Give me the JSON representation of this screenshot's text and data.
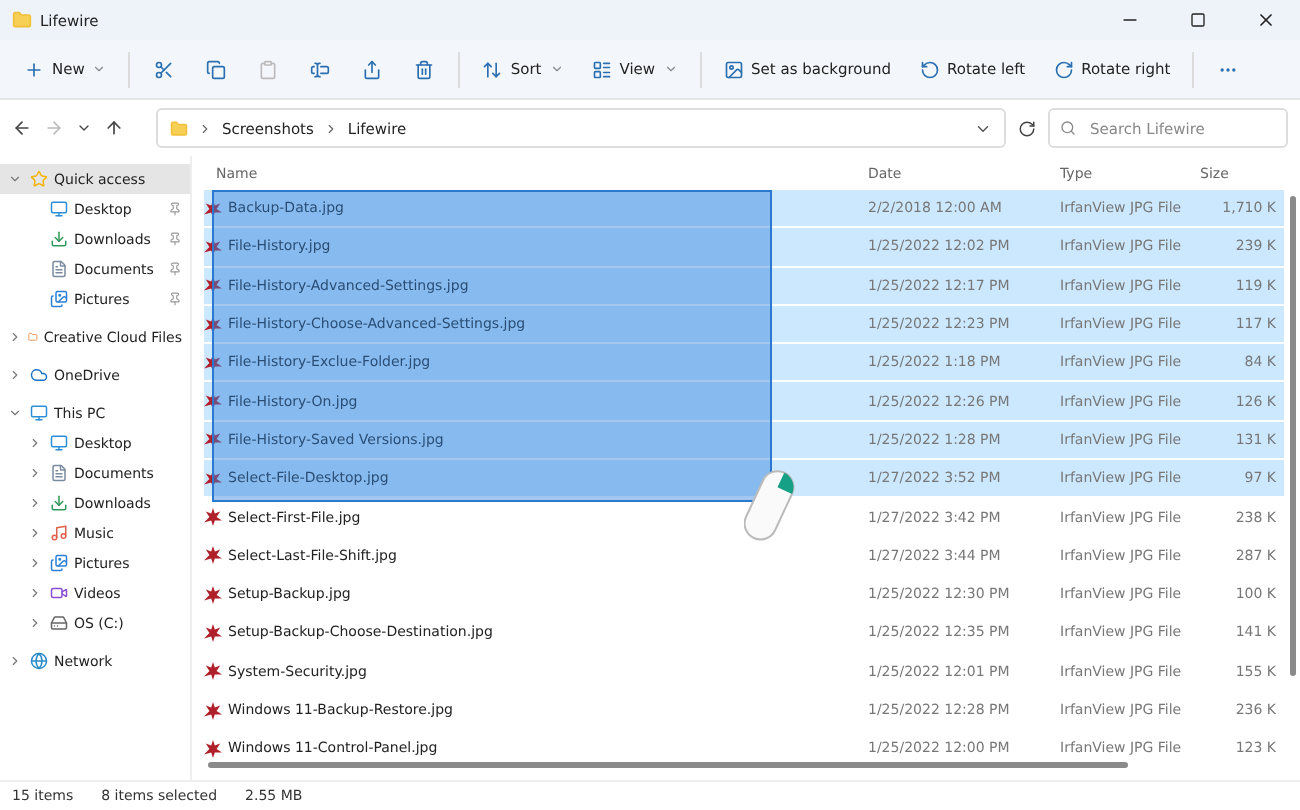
{
  "window": {
    "title": "Lifewire"
  },
  "toolbar": [
    {
      "kind": "new",
      "label": "New",
      "caret": true
    },
    {
      "kind": "cut",
      "disabled": false
    },
    {
      "kind": "copy",
      "disabled": false
    },
    {
      "kind": "paste",
      "disabled": true
    },
    {
      "kind": "rename",
      "disabled": false
    },
    {
      "kind": "share",
      "disabled": false
    },
    {
      "kind": "delete",
      "disabled": false
    },
    {
      "kind": "sort",
      "label": "Sort",
      "caret": true
    },
    {
      "kind": "view",
      "label": "View",
      "caret": true
    },
    {
      "kind": "background",
      "label": "Set as background"
    },
    {
      "kind": "rotleft",
      "label": "Rotate left"
    },
    {
      "kind": "rotright",
      "label": "Rotate right"
    },
    {
      "kind": "more"
    }
  ],
  "address": {
    "path": [
      "Screenshots",
      "Lifewire"
    ],
    "search_placeholder": "Search Lifewire"
  },
  "sidebar": {
    "items": [
      {
        "label": "Quick access",
        "kind": "star",
        "expanded": true,
        "selected": true,
        "children": [
          {
            "label": "Desktop",
            "kind": "desktop",
            "pinned": true,
            "selected": false
          },
          {
            "label": "Downloads",
            "kind": "download",
            "pinned": true,
            "selected": false
          },
          {
            "label": "Documents",
            "kind": "document",
            "pinned": true,
            "selected": false
          },
          {
            "label": "Pictures",
            "kind": "pictures",
            "pinned": true,
            "selected": false
          }
        ]
      },
      {
        "label": "Creative Cloud Files",
        "kind": "cloudfolder",
        "expanded": false,
        "selected": false
      },
      {
        "label": "OneDrive",
        "kind": "cloud",
        "expanded": false,
        "selected": false
      },
      {
        "label": "This PC",
        "kind": "pc",
        "expanded": true,
        "selected": false,
        "children": [
          {
            "label": "Desktop",
            "kind": "desktop",
            "expanded": false,
            "selected": false
          },
          {
            "label": "Documents",
            "kind": "document",
            "expanded": false,
            "selected": false
          },
          {
            "label": "Downloads",
            "kind": "download",
            "expanded": false,
            "selected": false
          },
          {
            "label": "Music",
            "kind": "music",
            "expanded": false,
            "selected": false
          },
          {
            "label": "Pictures",
            "kind": "pictures",
            "expanded": false,
            "selected": false
          },
          {
            "label": "Videos",
            "kind": "videos",
            "expanded": false,
            "selected": false
          },
          {
            "label": "OS (C:)",
            "kind": "drive",
            "expanded": false,
            "selected": false
          }
        ]
      },
      {
        "label": "Network",
        "kind": "network",
        "expanded": false,
        "selected": false
      }
    ]
  },
  "table": {
    "columns": [
      "Name",
      "Date",
      "Type",
      "Size"
    ],
    "rows": [
      {
        "name": "Backup-Data.jpg",
        "date": "2/2/2018 12:00 AM",
        "type": "IrfanView JPG File",
        "size": "1,710 K",
        "selected": true
      },
      {
        "name": "File-History.jpg",
        "date": "1/25/2022 12:02 PM",
        "type": "IrfanView JPG File",
        "size": "239 K",
        "selected": true
      },
      {
        "name": "File-History-Advanced-Settings.jpg",
        "date": "1/25/2022 12:17 PM",
        "type": "IrfanView JPG File",
        "size": "119 K",
        "selected": true
      },
      {
        "name": "File-History-Choose-Advanced-Settings.jpg",
        "date": "1/25/2022 12:23 PM",
        "type": "IrfanView JPG File",
        "size": "117 K",
        "selected": true
      },
      {
        "name": "File-History-Exclue-Folder.jpg",
        "date": "1/25/2022 1:18 PM",
        "type": "IrfanView JPG File",
        "size": "84 K",
        "selected": true
      },
      {
        "name": "File-History-On.jpg",
        "date": "1/25/2022 12:26 PM",
        "type": "IrfanView JPG File",
        "size": "126 K",
        "selected": true
      },
      {
        "name": "File-History-Saved Versions.jpg",
        "date": "1/25/2022 1:28 PM",
        "type": "IrfanView JPG File",
        "size": "131 K",
        "selected": true
      },
      {
        "name": "Select-File-Desktop.jpg",
        "date": "1/27/2022 3:52 PM",
        "type": "IrfanView JPG File",
        "size": "97 K",
        "selected": true
      },
      {
        "name": "Select-First-File.jpg",
        "date": "1/27/2022 3:42 PM",
        "type": "IrfanView JPG File",
        "size": "238 K",
        "selected": false
      },
      {
        "name": "Select-Last-File-Shift.jpg",
        "date": "1/27/2022 3:44 PM",
        "type": "IrfanView JPG File",
        "size": "287 K",
        "selected": false
      },
      {
        "name": "Setup-Backup.jpg",
        "date": "1/25/2022 12:30 PM",
        "type": "IrfanView JPG File",
        "size": "100 K",
        "selected": false
      },
      {
        "name": "Setup-Backup-Choose-Destination.jpg",
        "date": "1/25/2022 12:35 PM",
        "type": "IrfanView JPG File",
        "size": "141 K",
        "selected": false
      },
      {
        "name": "System-Security.jpg",
        "date": "1/25/2022 12:01 PM",
        "type": "IrfanView JPG File",
        "size": "155 K",
        "selected": false
      },
      {
        "name": "Windows 11-Backup-Restore.jpg",
        "date": "1/25/2022 12:28 PM",
        "type": "IrfanView JPG File",
        "size": "236 K",
        "selected": false
      },
      {
        "name": "Windows 11-Control-Panel.jpg",
        "date": "1/25/2022 12:00 PM",
        "type": "IrfanView JPG File",
        "size": "123 K",
        "selected": false
      }
    ]
  },
  "status_bar": {
    "count": "15 items",
    "selection": "8 items selected",
    "size": "2.55 MB"
  }
}
